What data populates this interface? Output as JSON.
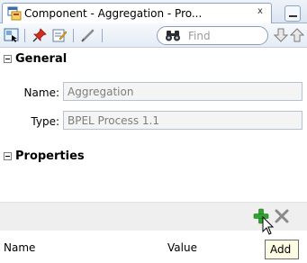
{
  "tab": {
    "title": "Component - Aggregation - Pro...",
    "close_glyph": "x",
    "icon": "component-icon"
  },
  "toolbar": {
    "find_placeholder": "Find",
    "icons": [
      "select-icon",
      "pin-icon",
      "edit-properties-icon",
      "pencil-icon",
      "binoculars-icon",
      "arrow-down-icon",
      "arrow-up-icon"
    ]
  },
  "general": {
    "title": "General",
    "fields": [
      {
        "label": "Name:",
        "value": "Aggregation"
      },
      {
        "label": "Type:",
        "value": "BPEL Process 1.1"
      }
    ]
  },
  "properties": {
    "title": "Properties",
    "columns": [
      "Name",
      "Value"
    ],
    "add_tooltip": "Add"
  },
  "colors": {
    "add_green": "#2fa32f",
    "remove_gray": "#8a8a8a",
    "tooltip_bg": "#fdfde3"
  }
}
